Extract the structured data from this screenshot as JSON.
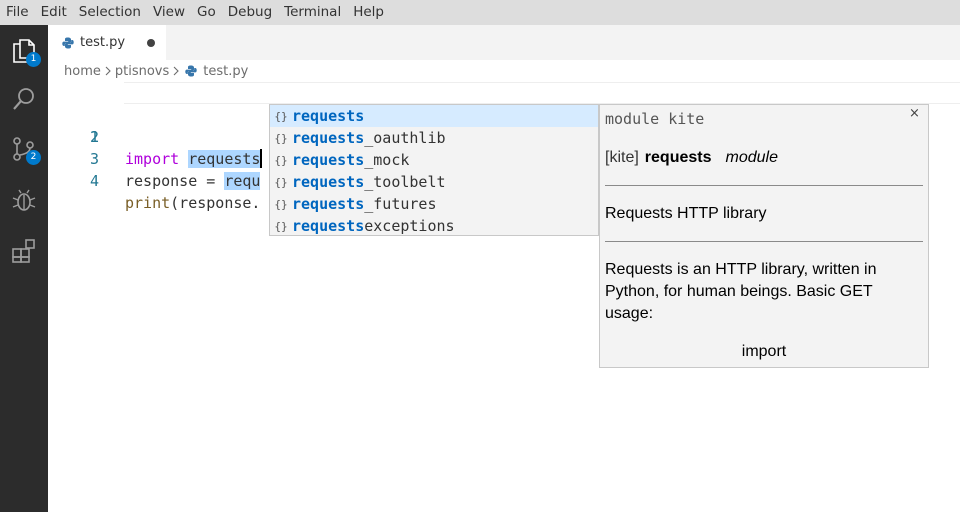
{
  "menubar": {
    "items": [
      "File",
      "Edit",
      "Selection",
      "View",
      "Go",
      "Debug",
      "Terminal",
      "Help"
    ]
  },
  "activity": {
    "explorer_badge": "1",
    "scm_badge": "2"
  },
  "tab": {
    "label": "test.py",
    "dirty": true
  },
  "breadcrumb": {
    "parts": [
      "home",
      "ptisnovs"
    ],
    "file": "test.py"
  },
  "editor": {
    "line_numbers": [
      "1",
      "2",
      "3",
      "4"
    ],
    "line1": {
      "keyword": "import",
      "module": "requests"
    },
    "line3": {
      "prefix": "response = ",
      "visible": "requ"
    },
    "line4": {
      "func": "print",
      "rest": "(response."
    }
  },
  "suggest": {
    "icon": "{}",
    "items": [
      {
        "match": "requests",
        "rest": ""
      },
      {
        "match": "requests",
        "rest": "_oauthlib"
      },
      {
        "match": "requests",
        "rest": "_mock"
      },
      {
        "match": "requests",
        "rest": "_toolbelt"
      },
      {
        "match": "requests",
        "rest": "_futures"
      },
      {
        "match": "requests",
        "rest": "exceptions"
      }
    ]
  },
  "details": {
    "header": "module kite",
    "close": "×",
    "title_tag": "[kite]",
    "title_name": "requests",
    "title_kind": "module",
    "summary": "Requests HTTP library",
    "description": "Requests is an HTTP library, written in Python, for human beings. Basic GET usage:",
    "code": "import"
  },
  "colors": {
    "accent": "#007acc",
    "keyword": "#af00db",
    "function": "#795e26",
    "match": "#0066bf",
    "selection": "#add6ff"
  }
}
